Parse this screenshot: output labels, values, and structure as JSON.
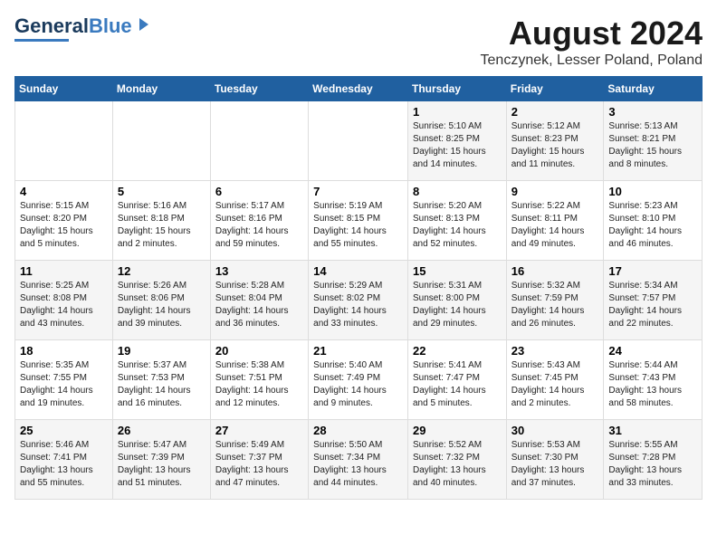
{
  "header": {
    "logo_general": "General",
    "logo_blue": "Blue",
    "main_title": "August 2024",
    "subtitle": "Tenczynek, Lesser Poland, Poland"
  },
  "calendar": {
    "headers": [
      "Sunday",
      "Monday",
      "Tuesday",
      "Wednesday",
      "Thursday",
      "Friday",
      "Saturday"
    ],
    "weeks": [
      [
        {
          "day": "",
          "text": ""
        },
        {
          "day": "",
          "text": ""
        },
        {
          "day": "",
          "text": ""
        },
        {
          "day": "",
          "text": ""
        },
        {
          "day": "1",
          "text": "Sunrise: 5:10 AM\nSunset: 8:25 PM\nDaylight: 15 hours\nand 14 minutes."
        },
        {
          "day": "2",
          "text": "Sunrise: 5:12 AM\nSunset: 8:23 PM\nDaylight: 15 hours\nand 11 minutes."
        },
        {
          "day": "3",
          "text": "Sunrise: 5:13 AM\nSunset: 8:21 PM\nDaylight: 15 hours\nand 8 minutes."
        }
      ],
      [
        {
          "day": "4",
          "text": "Sunrise: 5:15 AM\nSunset: 8:20 PM\nDaylight: 15 hours\nand 5 minutes."
        },
        {
          "day": "5",
          "text": "Sunrise: 5:16 AM\nSunset: 8:18 PM\nDaylight: 15 hours\nand 2 minutes."
        },
        {
          "day": "6",
          "text": "Sunrise: 5:17 AM\nSunset: 8:16 PM\nDaylight: 14 hours\nand 59 minutes."
        },
        {
          "day": "7",
          "text": "Sunrise: 5:19 AM\nSunset: 8:15 PM\nDaylight: 14 hours\nand 55 minutes."
        },
        {
          "day": "8",
          "text": "Sunrise: 5:20 AM\nSunset: 8:13 PM\nDaylight: 14 hours\nand 52 minutes."
        },
        {
          "day": "9",
          "text": "Sunrise: 5:22 AM\nSunset: 8:11 PM\nDaylight: 14 hours\nand 49 minutes."
        },
        {
          "day": "10",
          "text": "Sunrise: 5:23 AM\nSunset: 8:10 PM\nDaylight: 14 hours\nand 46 minutes."
        }
      ],
      [
        {
          "day": "11",
          "text": "Sunrise: 5:25 AM\nSunset: 8:08 PM\nDaylight: 14 hours\nand 43 minutes."
        },
        {
          "day": "12",
          "text": "Sunrise: 5:26 AM\nSunset: 8:06 PM\nDaylight: 14 hours\nand 39 minutes."
        },
        {
          "day": "13",
          "text": "Sunrise: 5:28 AM\nSunset: 8:04 PM\nDaylight: 14 hours\nand 36 minutes."
        },
        {
          "day": "14",
          "text": "Sunrise: 5:29 AM\nSunset: 8:02 PM\nDaylight: 14 hours\nand 33 minutes."
        },
        {
          "day": "15",
          "text": "Sunrise: 5:31 AM\nSunset: 8:00 PM\nDaylight: 14 hours\nand 29 minutes."
        },
        {
          "day": "16",
          "text": "Sunrise: 5:32 AM\nSunset: 7:59 PM\nDaylight: 14 hours\nand 26 minutes."
        },
        {
          "day": "17",
          "text": "Sunrise: 5:34 AM\nSunset: 7:57 PM\nDaylight: 14 hours\nand 22 minutes."
        }
      ],
      [
        {
          "day": "18",
          "text": "Sunrise: 5:35 AM\nSunset: 7:55 PM\nDaylight: 14 hours\nand 19 minutes."
        },
        {
          "day": "19",
          "text": "Sunrise: 5:37 AM\nSunset: 7:53 PM\nDaylight: 14 hours\nand 16 minutes."
        },
        {
          "day": "20",
          "text": "Sunrise: 5:38 AM\nSunset: 7:51 PM\nDaylight: 14 hours\nand 12 minutes."
        },
        {
          "day": "21",
          "text": "Sunrise: 5:40 AM\nSunset: 7:49 PM\nDaylight: 14 hours\nand 9 minutes."
        },
        {
          "day": "22",
          "text": "Sunrise: 5:41 AM\nSunset: 7:47 PM\nDaylight: 14 hours\nand 5 minutes."
        },
        {
          "day": "23",
          "text": "Sunrise: 5:43 AM\nSunset: 7:45 PM\nDaylight: 14 hours\nand 2 minutes."
        },
        {
          "day": "24",
          "text": "Sunrise: 5:44 AM\nSunset: 7:43 PM\nDaylight: 13 hours\nand 58 minutes."
        }
      ],
      [
        {
          "day": "25",
          "text": "Sunrise: 5:46 AM\nSunset: 7:41 PM\nDaylight: 13 hours\nand 55 minutes."
        },
        {
          "day": "26",
          "text": "Sunrise: 5:47 AM\nSunset: 7:39 PM\nDaylight: 13 hours\nand 51 minutes."
        },
        {
          "day": "27",
          "text": "Sunrise: 5:49 AM\nSunset: 7:37 PM\nDaylight: 13 hours\nand 47 minutes."
        },
        {
          "day": "28",
          "text": "Sunrise: 5:50 AM\nSunset: 7:34 PM\nDaylight: 13 hours\nand 44 minutes."
        },
        {
          "day": "29",
          "text": "Sunrise: 5:52 AM\nSunset: 7:32 PM\nDaylight: 13 hours\nand 40 minutes."
        },
        {
          "day": "30",
          "text": "Sunrise: 5:53 AM\nSunset: 7:30 PM\nDaylight: 13 hours\nand 37 minutes."
        },
        {
          "day": "31",
          "text": "Sunrise: 5:55 AM\nSunset: 7:28 PM\nDaylight: 13 hours\nand 33 minutes."
        }
      ]
    ]
  }
}
